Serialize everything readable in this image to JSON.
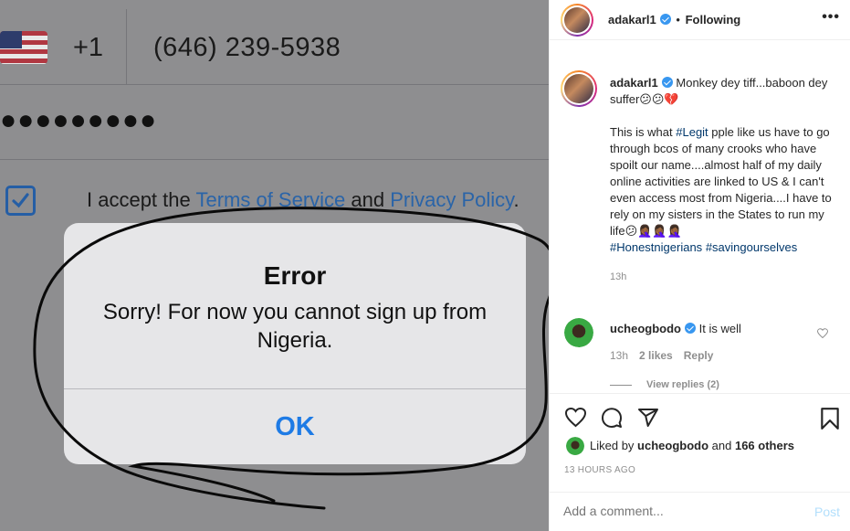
{
  "screenshot": {
    "country_code": "+1",
    "phone_number": "(646) 239-5938",
    "password_mask": "●●●●●●●●●",
    "accept_prefix": "I accept the ",
    "terms_link": "Terms of Service",
    "and_text": " and ",
    "privacy_link": "Privacy Policy",
    "period": ".",
    "alert": {
      "title": "Error",
      "message": "Sorry! For now you cannot sign up from Nigeria.",
      "ok_label": "OK"
    }
  },
  "post": {
    "author": "adakarl1",
    "follow_separator": "•",
    "follow_status": "Following",
    "more_label": "•••",
    "caption_lead": "Monkey dey tiff...baboon dey suffer😕😕💔",
    "caption_part1": "This is what ",
    "caption_tag": "#Legit",
    "caption_part2": " pple like us have to go through bcos of many crooks who have spoilt our name....almost half of my daily online activities are linked to US & I can't even access most from Nigeria....I have to rely on my sisters in the States to run my life😕🤦🏾‍♀️🤦🏾‍♀️🤦🏾‍♀️",
    "hashtags_1": "#Honestnigerians",
    "hashtags_2": "#savingourselves",
    "caption_time": "13h",
    "comment": {
      "user": "ucheogbodo",
      "text": "It is well",
      "time": "13h",
      "likes": "2 likes",
      "reply_label": "Reply",
      "view_replies": "View replies (2)"
    },
    "liked_by_prefix": "Liked by ",
    "liked_by_user": "ucheogbodo",
    "liked_by_and": " and ",
    "liked_by_others": "166 others",
    "timestamp": "13 HOURS AGO",
    "add_comment_placeholder": "Add a comment...",
    "post_label": "Post"
  },
  "colors": {
    "verified_badge": "#3897f0",
    "link_blue": "#00376b",
    "ios_blue": "#1e7be5",
    "post_button_disabled": "#b2dffc"
  }
}
